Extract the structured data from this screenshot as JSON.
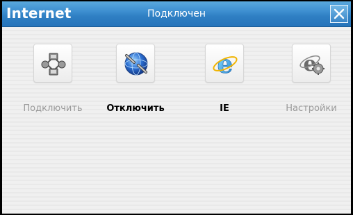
{
  "window": {
    "title": "Internet",
    "status": "Подключен"
  },
  "items": [
    {
      "label": "Подключить",
      "icon": "network-connect-icon",
      "enabled": false
    },
    {
      "label": "Отключить",
      "icon": "disconnect-globe-icon",
      "enabled": true
    },
    {
      "label": "IE",
      "icon": "internet-explorer-icon",
      "enabled": true
    },
    {
      "label": "Настройки",
      "icon": "ie-settings-gear-icon",
      "enabled": false
    }
  ],
  "colors": {
    "titlebar": "#3d8ed0",
    "content_bg": "#f0f0f0",
    "disabled_text": "#9a9a9a",
    "active_text": "#000000"
  }
}
